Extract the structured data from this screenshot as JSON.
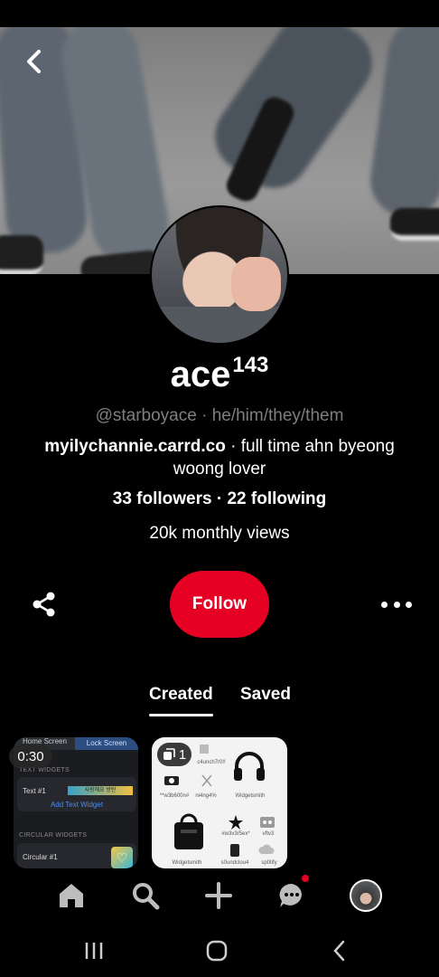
{
  "profile": {
    "name": "ace",
    "name_superscript": "143",
    "handle": "@starboyace",
    "pronouns": "he/him/they/them",
    "handle_separator": " · ",
    "bio_link": "myilychannie.carrd.co",
    "bio_text": " · full time ahn byeong woong lover",
    "followers": "33 followers",
    "following": "22 following",
    "stats_separator": " · ",
    "monthly_views": "20k monthly views"
  },
  "actions": {
    "follow_label": "Follow",
    "share_icon": "share-icon",
    "more_icon": "more-options-icon",
    "back_icon": "back-arrow-icon"
  },
  "tabs": [
    {
      "label": "Created",
      "active": true
    },
    {
      "label": "Saved",
      "active": false
    }
  ],
  "pins": [
    {
      "duration": "0:30",
      "header_left": "Home Screen",
      "header_right": "Lock Screen",
      "section1": "TEXT WIDGETS",
      "row1_label": "Text #1",
      "row1_bar": "사랑해요 방탄",
      "add_label": "Add Text Widget",
      "section2": "CIRCULAR WIDGETS",
      "row2_label": "Circular #1"
    },
    {
      "count": "1",
      "labels": [
        "c4unch7r0!!",
        "**w3b600n#",
        "ni4ng4%",
        "Widgetsmith",
        "#w3v3r5ex*",
        "vftv3",
        "Widgetsmith",
        "s0undclou4",
        "sp0tify"
      ]
    }
  ],
  "bottom_nav": [
    {
      "name": "home-icon"
    },
    {
      "name": "search-icon"
    },
    {
      "name": "plus-icon"
    },
    {
      "name": "messages-icon"
    },
    {
      "name": "profile-avatar"
    }
  ],
  "colors": {
    "accent": "#e60023",
    "background": "#000000",
    "muted_text": "#7f7f7f"
  }
}
